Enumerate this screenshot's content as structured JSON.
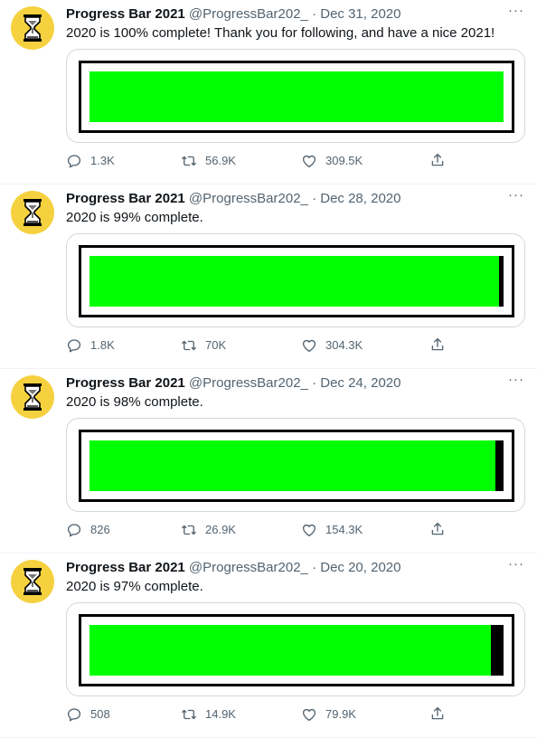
{
  "tweets": [
    {
      "name": "Progress Bar 2021",
      "handle": "@ProgressBar202_",
      "separator": "·",
      "date": "Dec 31, 2020",
      "text": "2020 is 100% complete! Thank you for following, and have a nice 2021!",
      "progress_percent": 100,
      "replies": "1.3K",
      "retweets": "56.9K",
      "likes": "309.5K"
    },
    {
      "name": "Progress Bar 2021",
      "handle": "@ProgressBar202_",
      "separator": "·",
      "date": "Dec 28, 2020",
      "text": "2020 is 99% complete.",
      "progress_percent": 99,
      "replies": "1.8K",
      "retweets": "70K",
      "likes": "304.3K"
    },
    {
      "name": "Progress Bar 2021",
      "handle": "@ProgressBar202_",
      "separator": "·",
      "date": "Dec 24, 2020",
      "text": "2020 is 98% complete.",
      "progress_percent": 98,
      "replies": "826",
      "retweets": "26.9K",
      "likes": "154.3K"
    },
    {
      "name": "Progress Bar 2021",
      "handle": "@ProgressBar202_",
      "separator": "·",
      "date": "Dec 20, 2020",
      "text": "2020 is 97% complete.",
      "progress_percent": 97,
      "replies": "508",
      "retweets": "14.9K",
      "likes": "79.9K"
    }
  ],
  "more_label": "···",
  "colors": {
    "avatar_bg": "#f5d13f",
    "bar_fill": "#00ff00",
    "bar_empty": "#000000",
    "secondary_text": "#536471"
  },
  "icons": {
    "avatar": "hourglass-icon",
    "reply": "reply-icon",
    "retweet": "retweet-icon",
    "like": "heart-icon",
    "share": "share-icon"
  }
}
